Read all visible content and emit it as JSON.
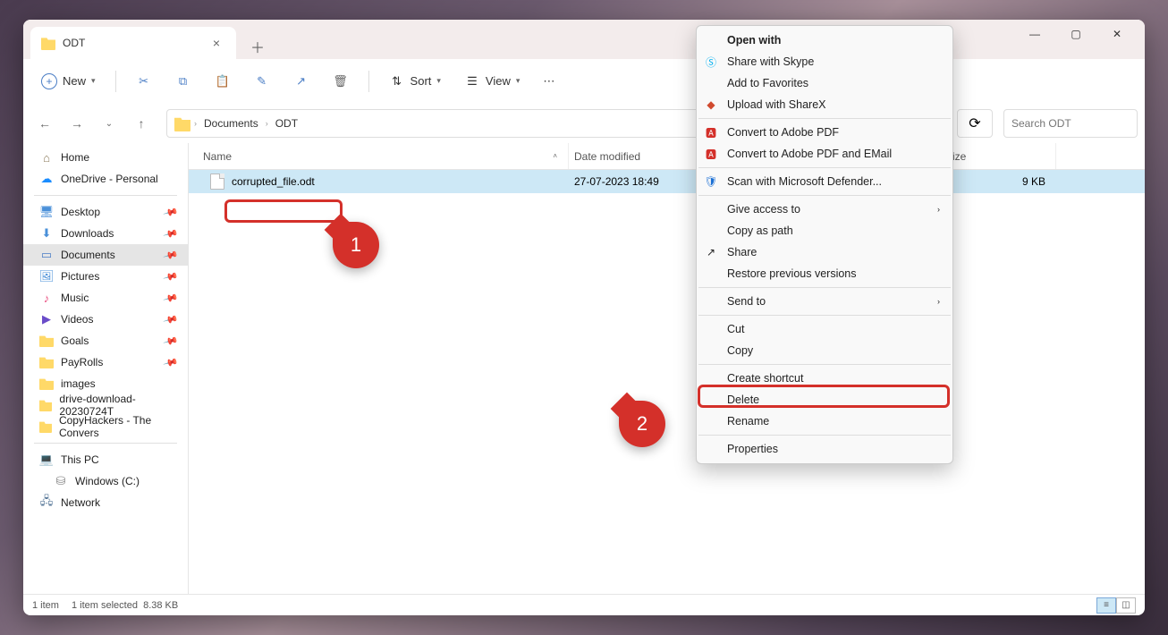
{
  "window": {
    "tabTitle": "ODT"
  },
  "toolbar": {
    "new": "New",
    "sort": "Sort",
    "view": "View"
  },
  "breadcrumb": {
    "items": [
      "Documents",
      "ODT"
    ]
  },
  "search": {
    "placeholder": "Search ODT"
  },
  "sidebar": {
    "home": "Home",
    "onedrive": "OneDrive - Personal",
    "desktop": "Desktop",
    "downloads": "Downloads",
    "documents": "Documents",
    "pictures": "Pictures",
    "music": "Music",
    "videos": "Videos",
    "goals": "Goals",
    "payrolls": "PayRolls",
    "images": "images",
    "drivedl": "drive-download-20230724T",
    "copyhackers": "CopyHackers - The Convers",
    "thispc": "This PC",
    "cdrive": "Windows (C:)",
    "network": "Network"
  },
  "columns": {
    "name": "Name",
    "date": "Date modified",
    "type": "",
    "size": "Size"
  },
  "file": {
    "name": "corrupted_file.odt",
    "date": "27-07-2023 18:49",
    "typeEllipsis": "…",
    "size": "9 KB"
  },
  "status": {
    "count": "1 item",
    "selected": "1 item selected",
    "filesize": "8.38 KB"
  },
  "ctx": {
    "openwith": "Open with",
    "skype": "Share with Skype",
    "favorites": "Add to Favorites",
    "sharex": "Upload with ShareX",
    "adobepdf": "Convert to Adobe PDF",
    "adobeemail": "Convert to Adobe PDF and EMail",
    "defender": "Scan with Microsoft Defender...",
    "giveaccess": "Give access to",
    "copypath": "Copy as path",
    "share": "Share",
    "restore": "Restore previous versions",
    "sendto": "Send to",
    "cut": "Cut",
    "copy": "Copy",
    "shortcut": "Create shortcut",
    "delete": "Delete",
    "rename": "Rename",
    "properties": "Properties"
  },
  "callouts": {
    "one": "1",
    "two": "2"
  }
}
